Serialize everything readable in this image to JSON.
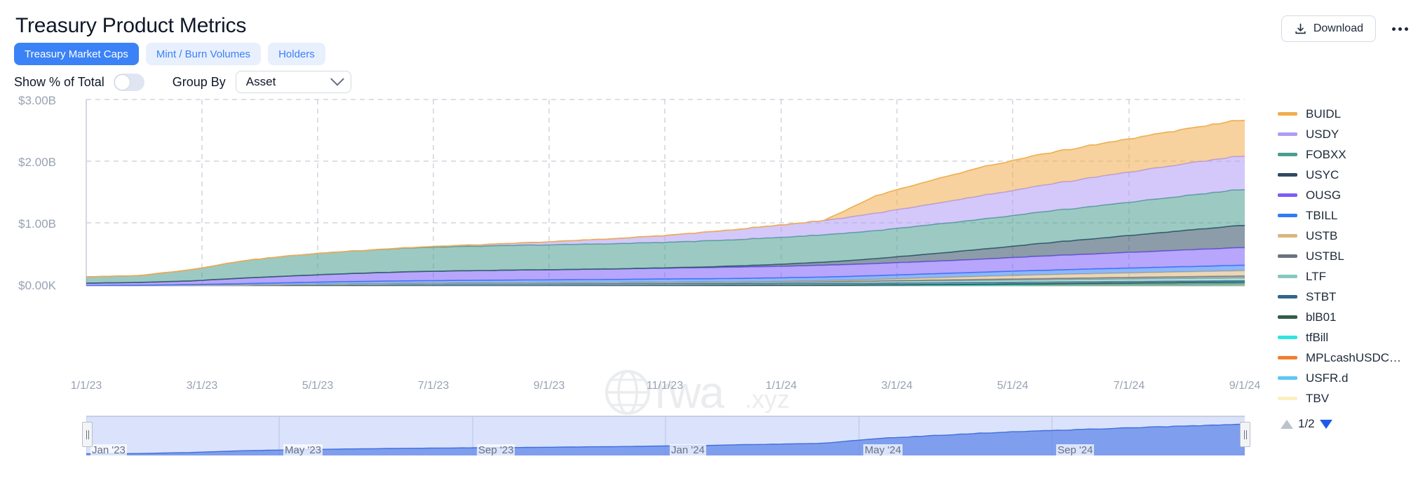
{
  "header": {
    "title": "Treasury Product Metrics",
    "download_label": "Download",
    "download_icon": "download-icon",
    "kebab_icon": "more-horizontal-icon"
  },
  "tabs": [
    {
      "label": "Treasury Market Caps",
      "active": true
    },
    {
      "label": "Mint / Burn Volumes",
      "active": false
    },
    {
      "label": "Holders",
      "active": false
    }
  ],
  "controls": {
    "show_pct_label": "Show % of Total",
    "toggle_state": "off",
    "group_by_label": "Group By",
    "group_by_value": "Asset",
    "chevron_icon": "chevron-down-icon"
  },
  "watermark": {
    "text": "rwa",
    "suffix": ".xyz",
    "icon": "globe-icon"
  },
  "legend": {
    "page_indicator": "1/2",
    "prev_icon": "triangle-up-icon",
    "next_icon": "triangle-down-icon",
    "items": [
      {
        "label": "BUIDL",
        "color": "#f0ad4e"
      },
      {
        "label": "USDY",
        "color": "#b09bf5"
      },
      {
        "label": "FOBXX",
        "color": "#4a9e8f"
      },
      {
        "label": "USYC",
        "color": "#2d4a63"
      },
      {
        "label": "OUSG",
        "color": "#7c5cfa"
      },
      {
        "label": "TBILL",
        "color": "#2f7bf6"
      },
      {
        "label": "USTB",
        "color": "#d9b77e"
      },
      {
        "label": "USTBL",
        "color": "#6b7280"
      },
      {
        "label": "LTF",
        "color": "#86c8bc"
      },
      {
        "label": "STBT",
        "color": "#2f6690"
      },
      {
        "label": "blB01",
        "color": "#2f5d4a"
      },
      {
        "label": "tfBill",
        "color": "#2ee6e0"
      },
      {
        "label": "MPLcashUSDC…",
        "color": "#f08030"
      },
      {
        "label": "USFR.d",
        "color": "#5bc8f5"
      },
      {
        "label": "TBV",
        "color": "#fcefc0"
      }
    ]
  },
  "navigator": {
    "labels": [
      "Jan '23",
      "May '23",
      "Sep '23",
      "Jan '24",
      "May '24",
      "Sep '24"
    ],
    "left_handle": "navigator-left-handle",
    "right_handle": "navigator-right-handle"
  },
  "chart_data": {
    "type": "area",
    "stacked": true,
    "title": "Treasury Market Caps",
    "xlabel": "",
    "ylabel": "",
    "grid": true,
    "legend_position": "right",
    "ylim": [
      0,
      3000000000
    ],
    "ytick_labels": [
      "$0.00K",
      "$1.00B",
      "$2.00B",
      "$3.00B"
    ],
    "ytick_values": [
      0,
      1000000000,
      2000000000,
      3000000000
    ],
    "xtick_labels": [
      "1/1/23",
      "3/1/23",
      "5/1/23",
      "7/1/23",
      "9/1/23",
      "11/1/23",
      "1/1/24",
      "3/1/24",
      "5/1/24",
      "7/1/24",
      "9/1/24"
    ],
    "x": [
      "2023-01-01",
      "2023-02-01",
      "2023-03-01",
      "2023-04-01",
      "2023-05-01",
      "2023-06-01",
      "2023-07-01",
      "2023-08-01",
      "2023-09-01",
      "2023-10-01",
      "2023-11-01",
      "2023-12-01",
      "2024-01-01",
      "2024-02-01",
      "2024-03-01",
      "2024-04-01",
      "2024-05-01",
      "2024-06-01",
      "2024-07-01",
      "2024-08-01",
      "2024-09-01",
      "2024-10-01",
      "2024-10-20"
    ],
    "units": "USD",
    "series": [
      {
        "name": "BUIDL",
        "color": "#f0ad4e",
        "values": [
          0,
          0,
          0,
          0,
          0,
          0,
          0,
          0,
          0,
          0,
          0,
          0,
          0,
          0,
          0,
          280000000,
          380000000,
          460000000,
          500000000,
          520000000,
          540000000,
          560000000,
          580000000
        ]
      },
      {
        "name": "USDY",
        "color": "#b09bf5",
        "values": [
          0,
          0,
          0,
          0,
          0,
          0,
          5000000,
          15000000,
          30000000,
          55000000,
          80000000,
          110000000,
          150000000,
          190000000,
          230000000,
          280000000,
          330000000,
          380000000,
          420000000,
          460000000,
          490000000,
          520000000,
          540000000
        ]
      },
      {
        "name": "FOBXX",
        "color": "#4a9e8f",
        "values": [
          100000000,
          110000000,
          180000000,
          280000000,
          330000000,
          360000000,
          380000000,
          390000000,
          395000000,
          400000000,
          405000000,
          410000000,
          420000000,
          430000000,
          440000000,
          450000000,
          465000000,
          480000000,
          500000000,
          520000000,
          540000000,
          560000000,
          580000000
        ]
      },
      {
        "name": "USYC",
        "color": "#2d4a63",
        "values": [
          0,
          0,
          0,
          0,
          0,
          0,
          0,
          0,
          0,
          0,
          0,
          5000000,
          15000000,
          30000000,
          50000000,
          80000000,
          120000000,
          160000000,
          200000000,
          240000000,
          280000000,
          320000000,
          360000000
        ]
      },
      {
        "name": "OUSG",
        "color": "#7c5cfa",
        "values": [
          40000000,
          45000000,
          60000000,
          90000000,
          110000000,
          130000000,
          145000000,
          155000000,
          160000000,
          165000000,
          170000000,
          175000000,
          180000000,
          185000000,
          190000000,
          195000000,
          200000000,
          210000000,
          225000000,
          240000000,
          255000000,
          270000000,
          285000000
        ]
      },
      {
        "name": "TBILL",
        "color": "#2f7bf6",
        "values": [
          5000000,
          8000000,
          15000000,
          25000000,
          32000000,
          38000000,
          42000000,
          45000000,
          47000000,
          49000000,
          51000000,
          53000000,
          55000000,
          57000000,
          59000000,
          62000000,
          65000000,
          68000000,
          72000000,
          76000000,
          80000000,
          84000000,
          88000000
        ]
      },
      {
        "name": "USTB",
        "color": "#d9b77e",
        "values": [
          0,
          0,
          0,
          0,
          0,
          0,
          0,
          0,
          0,
          0,
          0,
          0,
          0,
          5000000,
          12000000,
          22000000,
          35000000,
          48000000,
          58000000,
          66000000,
          72000000,
          78000000,
          84000000
        ]
      },
      {
        "name": "USTBL",
        "color": "#6b7280",
        "values": [
          0,
          0,
          0,
          0,
          0,
          0,
          0,
          0,
          0,
          0,
          0,
          0,
          0,
          0,
          3000000,
          8000000,
          14000000,
          19000000,
          23000000,
          26000000,
          29000000,
          32000000,
          35000000
        ]
      },
      {
        "name": "LTF",
        "color": "#86c8bc",
        "values": [
          0,
          0,
          0,
          0,
          2000000,
          5000000,
          8000000,
          11000000,
          13000000,
          15000000,
          17000000,
          19000000,
          21000000,
          23000000,
          25000000,
          27000000,
          29000000,
          31000000,
          33000000,
          35000000,
          37000000,
          39000000,
          41000000
        ]
      },
      {
        "name": "STBT",
        "color": "#2f6690",
        "values": [
          0,
          2000000,
          6000000,
          12000000,
          20000000,
          26000000,
          30000000,
          32000000,
          33000000,
          34000000,
          34000000,
          34000000,
          33000000,
          32000000,
          31000000,
          30000000,
          29000000,
          28000000,
          27000000,
          26000000,
          25000000,
          24000000,
          23000000
        ]
      },
      {
        "name": "blB01",
        "color": "#2f5d4a",
        "values": [
          0,
          0,
          0,
          0,
          0,
          0,
          0,
          0,
          0,
          0,
          2000000,
          5000000,
          8000000,
          10000000,
          12000000,
          14000000,
          16000000,
          18000000,
          20000000,
          22000000,
          24000000,
          26000000,
          28000000
        ]
      },
      {
        "name": "tfBill",
        "color": "#2ee6e0",
        "values": [
          0,
          0,
          0,
          0,
          0,
          0,
          0,
          0,
          0,
          0,
          0,
          0,
          0,
          0,
          0,
          2000000,
          4000000,
          6000000,
          8000000,
          10000000,
          12000000,
          14000000,
          16000000
        ]
      },
      {
        "name": "MPLcashUSDC…",
        "color": "#f08030",
        "values": [
          0,
          0,
          0,
          0,
          0,
          0,
          0,
          0,
          0,
          0,
          0,
          0,
          0,
          0,
          0,
          0,
          1000000,
          2000000,
          3000000,
          4000000,
          5000000,
          6000000,
          7000000
        ]
      },
      {
        "name": "USFR.d",
        "color": "#5bc8f5",
        "values": [
          0,
          0,
          0,
          0,
          0,
          0,
          0,
          0,
          0,
          0,
          0,
          0,
          0,
          0,
          0,
          0,
          0,
          1000000,
          2000000,
          3000000,
          4000000,
          5000000,
          6000000
        ]
      },
      {
        "name": "TBV",
        "color": "#fcefc0",
        "values": [
          0,
          0,
          0,
          0,
          0,
          0,
          0,
          0,
          0,
          0,
          0,
          0,
          0,
          0,
          0,
          0,
          0,
          0,
          1000000,
          2000000,
          3000000,
          4000000,
          5000000
        ]
      }
    ],
    "navigator_series": {
      "name": "Total",
      "color": "#5c83e8",
      "values": [
        145000000,
        165000000,
        261000000,
        407000000,
        494000000,
        559000000,
        610000000,
        648000000,
        678000000,
        718000000,
        759000000,
        811000000,
        882000000,
        962000000,
        1052000000,
        1450000000,
        1688000000,
        1915000000,
        2092000000,
        2247000000,
        2396000000,
        2545000000,
        2678000000
      ]
    }
  }
}
